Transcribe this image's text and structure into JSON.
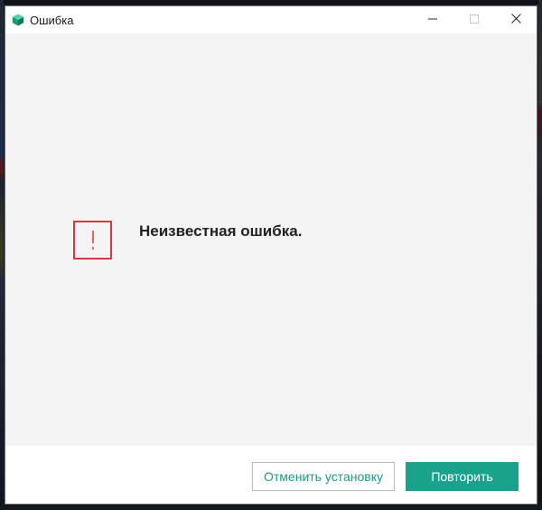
{
  "window": {
    "title": "Ошибка",
    "app_icon": "kaspersky-cube-icon",
    "controls": [
      "minimize-icon",
      "maximize-icon",
      "close-icon"
    ]
  },
  "error": {
    "icon": "exclamation-icon",
    "message": "Неизвестная ошибка."
  },
  "footer": {
    "cancel_label": "Отменить установку",
    "retry_label": "Повторить"
  },
  "colors": {
    "accent": "#1ba28d",
    "error": "#e1353d",
    "content_bg": "#f4f4f4"
  }
}
